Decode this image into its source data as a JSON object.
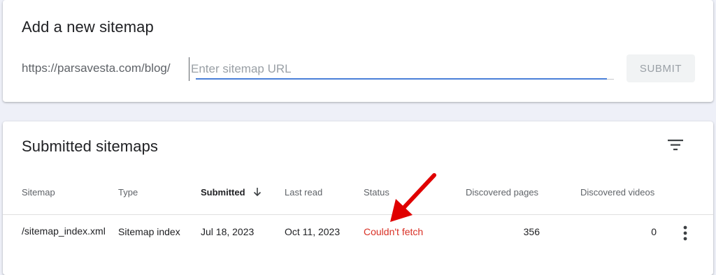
{
  "add_sitemap": {
    "title": "Add a new sitemap",
    "url_prefix": "https://parsavesta.com/blog/",
    "input_value": "",
    "input_placeholder": "Enter sitemap URL",
    "submit_label": "SUBMIT"
  },
  "submitted": {
    "title": "Submitted sitemaps",
    "columns": {
      "sitemap": "Sitemap",
      "type": "Type",
      "submitted": "Submitted",
      "last_read": "Last read",
      "status": "Status",
      "pages": "Discovered pages",
      "videos": "Discovered videos"
    },
    "rows": [
      {
        "sitemap": "/sitemap_index.xml",
        "type": "Sitemap index",
        "submitted": "Jul 18, 2023",
        "last_read": "Oct 11, 2023",
        "status": "Couldn't fetch",
        "pages": "356",
        "videos": "0"
      }
    ]
  },
  "colors": {
    "accent": "#4a7fd8",
    "error": "#d93025",
    "annotation_arrow": "#e00000"
  },
  "icons": {
    "filter": "filter-icon",
    "sort": "arrow-down-icon",
    "more": "more-vert-icon"
  }
}
